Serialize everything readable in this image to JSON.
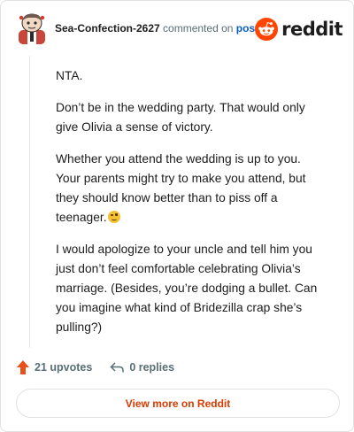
{
  "comment": {
    "author": "Sea-Confection-2627",
    "action_text": "commented on",
    "post_link": "post",
    "brand": "reddit",
    "paragraphs": [
      "NTA.",
      "Don’t be in the wedding party. That would only give Olivia a sense of victory.",
      "Whether you attend the wedding is up to you. Your parents might try to make you attend, but they should know better than to piss off a teenager.",
      "I would apologize to your uncle and tell him you just don’t feel comfortable celebrating Olivia’s marriage. (Besides, you’re dodging a bullet. Can you imagine what kind of Bridezilla crap she’s pulling?)"
    ],
    "emoji_icon": "smirk-emoji-icon"
  },
  "footer": {
    "upvotes_label": "21 upvotes",
    "replies_label": "0 replies",
    "view_more_label": "View more on Reddit"
  },
  "colors": {
    "reddit_orange": "#ff4500",
    "link_blue": "#0a5cc2",
    "view_more_text": "#d93a00",
    "muted_text": "#576f76"
  }
}
